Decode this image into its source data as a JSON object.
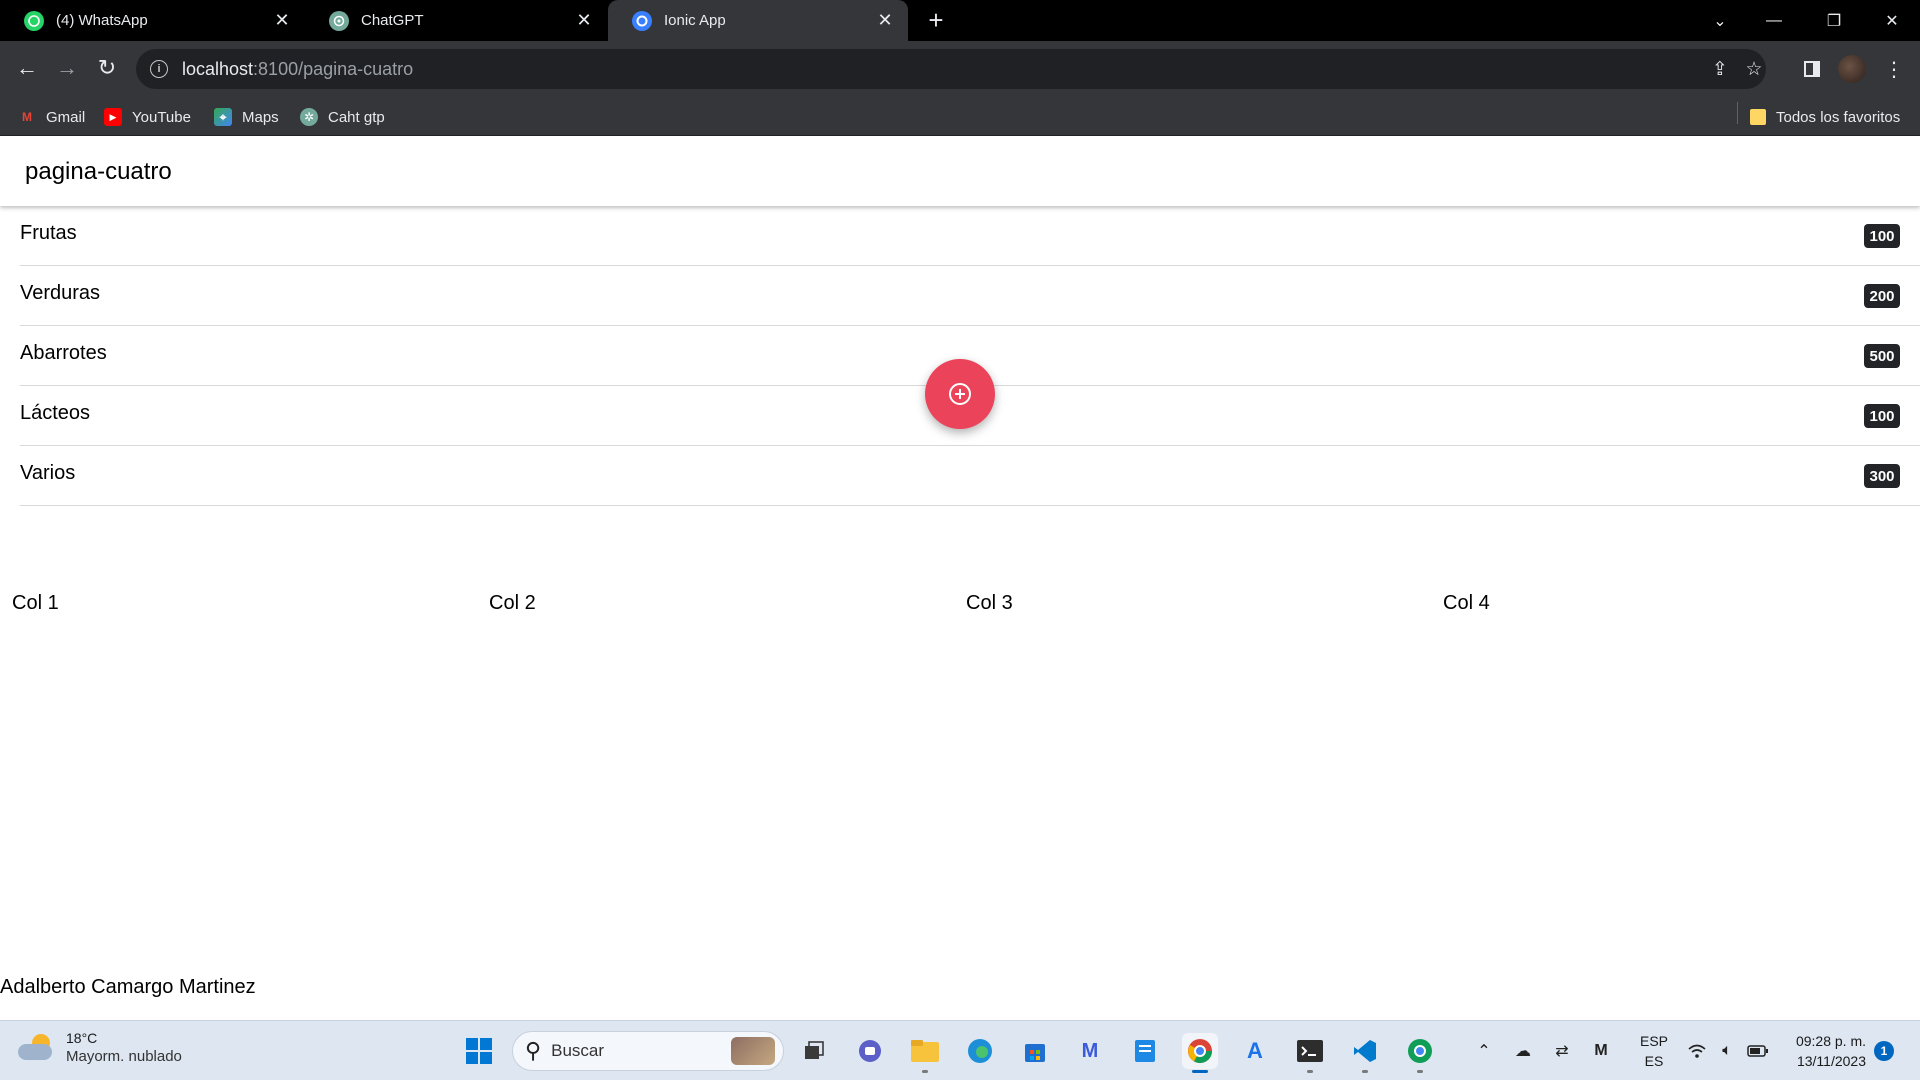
{
  "browser": {
    "tabs": [
      {
        "title": "(4) WhatsApp",
        "icon": "whatsapp-icon",
        "active": false
      },
      {
        "title": "ChatGPT",
        "icon": "chatgpt-icon",
        "active": false
      },
      {
        "title": "Ionic App",
        "icon": "ionic-icon",
        "active": true
      }
    ],
    "address": {
      "host": "localhost",
      "path": ":8100/pagina-cuatro"
    },
    "bookmarks": [
      {
        "label": "Gmail",
        "icon": "gmail-icon"
      },
      {
        "label": "YouTube",
        "icon": "youtube-icon"
      },
      {
        "label": "Maps",
        "icon": "maps-icon"
      },
      {
        "label": "Caht gtp",
        "icon": "chatgpt-icon"
      }
    ],
    "all_bookmarks_label": "Todos los favoritos"
  },
  "page": {
    "header_title": "pagina-cuatro",
    "list_items": [
      {
        "label": "Frutas",
        "badge": "100"
      },
      {
        "label": "Verduras",
        "badge": "200"
      },
      {
        "label": "Abarrotes",
        "badge": "500"
      },
      {
        "label": "Lácteos",
        "badge": "100"
      },
      {
        "label": "Varios",
        "badge": "300"
      }
    ],
    "fab_icon": "add-circle-outline-icon",
    "fab_color": "#eb445a",
    "columns": [
      "Col 1",
      "Col 2",
      "Col 3",
      "Col 4"
    ],
    "footer_name": "Adalberto Camargo Martinez"
  },
  "taskbar": {
    "weather": {
      "temp": "18°C",
      "condition": "Mayorm. nublado"
    },
    "search_placeholder": "Buscar",
    "language": {
      "line1": "ESP",
      "line2": "ES"
    },
    "time": "09:28 p. m.",
    "date": "13/11/2023",
    "notifications": "1"
  }
}
